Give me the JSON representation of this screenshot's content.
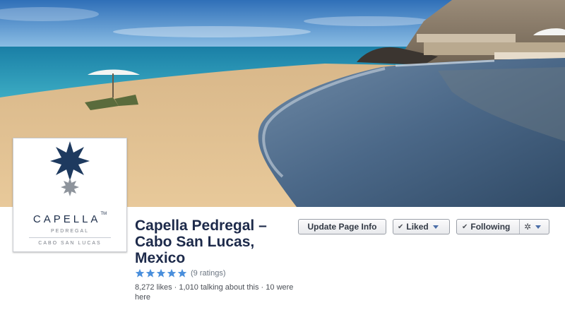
{
  "page": {
    "name": "Capella Pedregal – Cabo San Lucas, Mexico",
    "rating_stars": 5,
    "rating_count_text": "(9 ratings)",
    "stats_text": "8,272 likes · 1,010 talking about this · 10 were here"
  },
  "profile_logo": {
    "brand": "CAPELLA",
    "trademark": "TM",
    "sub": "PEDREGAL",
    "location": "CABO SAN LUCAS",
    "colors": {
      "primary_star": "#1e3a5f",
      "secondary_star": "#8e949c"
    }
  },
  "actions": {
    "update_info_label": "Update Page Info",
    "liked_label": "Liked",
    "following_label": "Following"
  },
  "icons": {
    "check": "check-icon",
    "caret": "caret-down-icon",
    "gear": "gear-icon",
    "rating_star": "star-icon"
  },
  "colors": {
    "title": "#1d2a4a",
    "rating_star": "#4a8fdc",
    "caret": "#4a6da7"
  }
}
